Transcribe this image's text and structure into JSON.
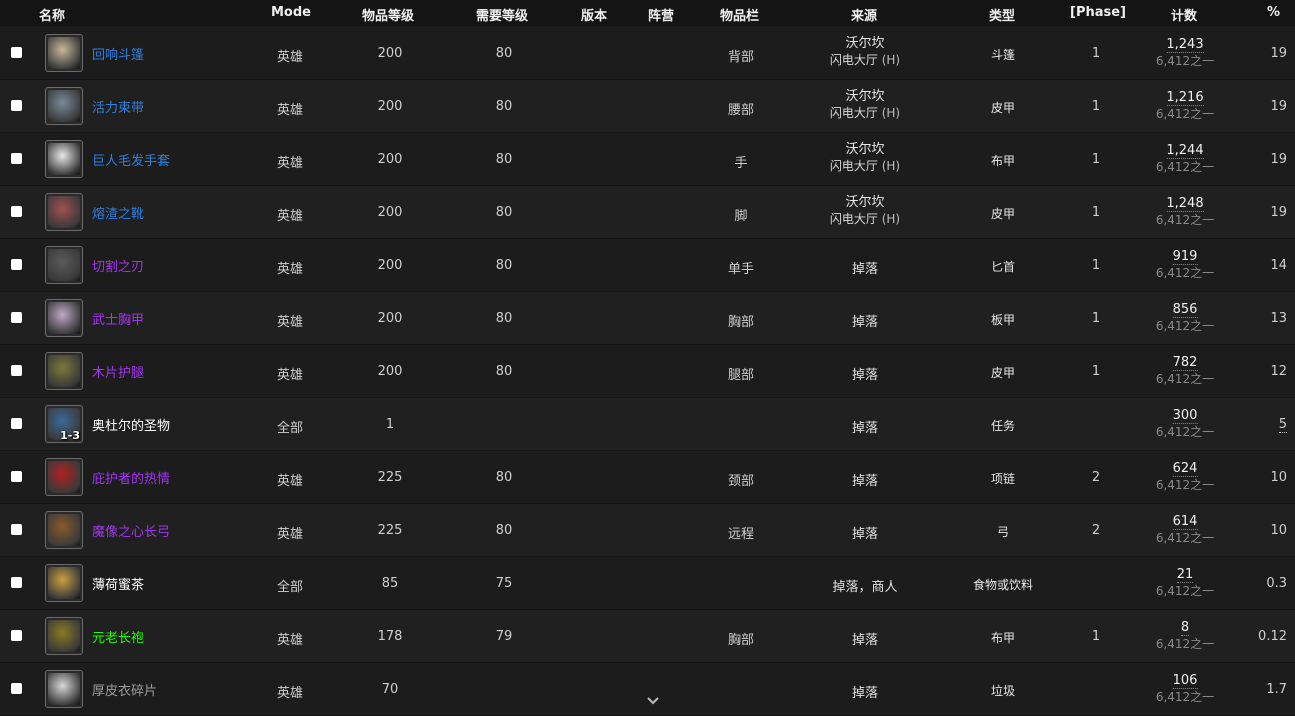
{
  "headers": {
    "name": "名称",
    "mode": "Mode",
    "item_level": "物品等级",
    "req_level": "需要等级",
    "version": "版本",
    "faction": "阵营",
    "slot": "物品栏",
    "source": "来源",
    "type": "类型",
    "phase": "[Phase]",
    "count": "计数",
    "pct": "%"
  },
  "rows": [
    {
      "name": "回响斗篷",
      "quality": "rare",
      "mode": "英雄",
      "ilvl": "200",
      "req": "80",
      "slot": "背部",
      "source_main": "沃尔坎",
      "source_sub": "闪电大厅",
      "source_tag": "(H)",
      "type": "斗篷",
      "phase": "1",
      "count": "1,243",
      "of": "6,412之一",
      "pct": "19",
      "icon": "cloak-icon",
      "icon_color": "#c9b89a"
    },
    {
      "name": "活力束带",
      "quality": "rare",
      "mode": "英雄",
      "ilvl": "200",
      "req": "80",
      "slot": "腰部",
      "source_main": "沃尔坎",
      "source_sub": "闪电大厅",
      "source_tag": "(H)",
      "type": "皮甲",
      "phase": "1",
      "count": "1,216",
      "of": "6,412之一",
      "pct": "19",
      "icon": "belt-icon",
      "icon_color": "#7a8a99"
    },
    {
      "name": "巨人毛发手套",
      "quality": "rare",
      "mode": "英雄",
      "ilvl": "200",
      "req": "80",
      "slot": "手",
      "source_main": "沃尔坎",
      "source_sub": "闪电大厅",
      "source_tag": "(H)",
      "type": "布甲",
      "phase": "1",
      "count": "1,244",
      "of": "6,412之一",
      "pct": "19",
      "icon": "glove-icon",
      "icon_color": "#e8e8e8"
    },
    {
      "name": "熔渣之靴",
      "quality": "rare",
      "mode": "英雄",
      "ilvl": "200",
      "req": "80",
      "slot": "脚",
      "source_main": "沃尔坎",
      "source_sub": "闪电大厅",
      "source_tag": "(H)",
      "type": "皮甲",
      "phase": "1",
      "count": "1,248",
      "of": "6,412之一",
      "pct": "19",
      "icon": "boot-icon",
      "icon_color": "#a35050"
    },
    {
      "name": "切割之刃",
      "quality": "epic",
      "mode": "英雄",
      "ilvl": "200",
      "req": "80",
      "slot": "单手",
      "source_main": "掉落",
      "source_sub": "",
      "source_tag": "",
      "type": "匕首",
      "phase": "1",
      "count": "919",
      "of": "6,412之一",
      "pct": "14",
      "icon": "dagger-icon",
      "icon_color": "#5a5a5a"
    },
    {
      "name": "武士胸甲",
      "quality": "epic",
      "mode": "英雄",
      "ilvl": "200",
      "req": "80",
      "slot": "胸部",
      "source_main": "掉落",
      "source_sub": "",
      "source_tag": "",
      "type": "板甲",
      "phase": "1",
      "count": "856",
      "of": "6,412之一",
      "pct": "13",
      "icon": "chestplate-icon",
      "icon_color": "#c0a8c8"
    },
    {
      "name": "木片护腿",
      "quality": "epic",
      "mode": "英雄",
      "ilvl": "200",
      "req": "80",
      "slot": "腿部",
      "source_main": "掉落",
      "source_sub": "",
      "source_tag": "",
      "type": "皮甲",
      "phase": "1",
      "count": "782",
      "of": "6,412之一",
      "pct": "12",
      "icon": "leggings-icon",
      "icon_color": "#7a7a3a"
    },
    {
      "name": "奥杜尔的圣物",
      "quality": "common",
      "mode": "全部",
      "ilvl": "1",
      "req": "",
      "slot": "",
      "source_main": "掉落",
      "source_sub": "",
      "source_tag": "",
      "type": "任务",
      "phase": "",
      "count": "300",
      "of": "6,412之一",
      "pct": "5",
      "icon": "relic-icon",
      "icon_color": "#3a6a9a",
      "qty": "1-3",
      "pct_ul": true
    },
    {
      "name": "庇护者的热情",
      "quality": "epic",
      "mode": "英雄",
      "ilvl": "225",
      "req": "80",
      "slot": "颈部",
      "source_main": "掉落",
      "source_sub": "",
      "source_tag": "",
      "type": "项链",
      "phase": "2",
      "count": "624",
      "of": "6,412之一",
      "pct": "10",
      "icon": "necklace-icon",
      "icon_color": "#b02020"
    },
    {
      "name": "魔像之心长弓",
      "quality": "epic",
      "mode": "英雄",
      "ilvl": "225",
      "req": "80",
      "slot": "远程",
      "source_main": "掉落",
      "source_sub": "",
      "source_tag": "",
      "type": "弓",
      "phase": "2",
      "count": "614",
      "of": "6,412之一",
      "pct": "10",
      "icon": "bow-icon",
      "icon_color": "#8a5a2a"
    },
    {
      "name": "薄荷蜜茶",
      "quality": "common",
      "mode": "全部",
      "ilvl": "85",
      "req": "75",
      "slot": "",
      "source_main": "掉落，商人",
      "source_sub": "",
      "source_tag": "",
      "type": "食物或饮料",
      "phase": "",
      "count": "21",
      "of": "6,412之一",
      "pct": "0.3",
      "icon": "tea-icon",
      "icon_color": "#c8a040"
    },
    {
      "name": "元老长袍",
      "quality": "uncommon",
      "mode": "英雄",
      "ilvl": "178",
      "req": "79",
      "slot": "胸部",
      "source_main": "掉落",
      "source_sub": "",
      "source_tag": "",
      "type": "布甲",
      "phase": "1",
      "count": "8",
      "of": "6,412之一",
      "pct": "0.12",
      "icon": "robe-icon",
      "icon_color": "#8a7a20"
    },
    {
      "name": "厚皮衣碎片",
      "quality": "poor",
      "mode": "英雄",
      "ilvl": "70",
      "req": "",
      "slot": "",
      "source_main": "掉落",
      "source_sub": "",
      "source_tag": "",
      "type": "垃圾",
      "phase": "",
      "count": "106",
      "of": "6,412之一",
      "pct": "1.7",
      "icon": "scrap-icon",
      "icon_color": "#d8d8d8"
    }
  ]
}
